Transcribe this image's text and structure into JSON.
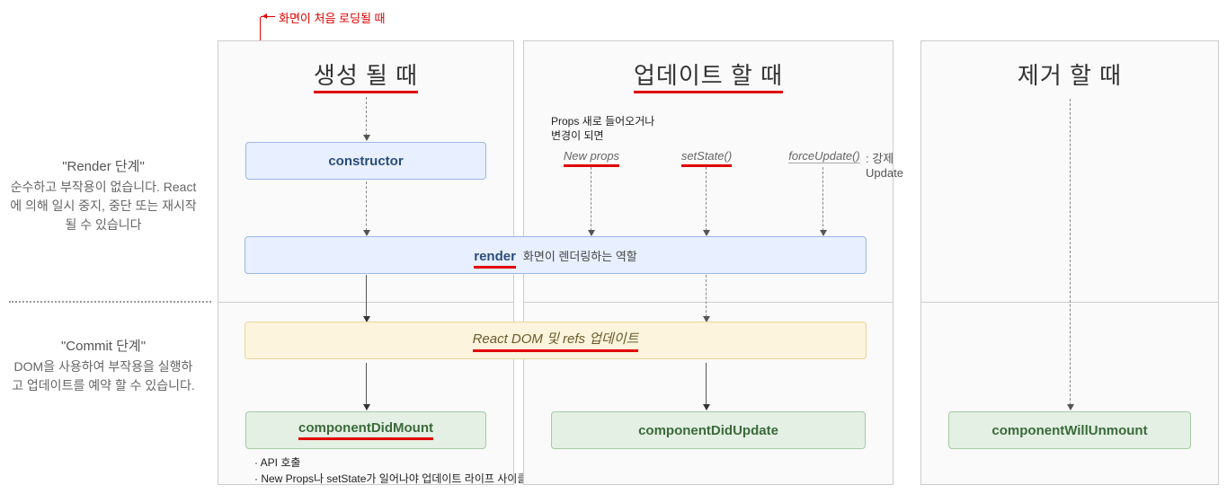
{
  "annotations": {
    "top": "화면이 처음 로딩될 때",
    "props_note_line1": "Props 새로 들어오거나",
    "props_note_line2": "변경이 되면",
    "force_note": ": 강제 Update",
    "render_note": "화면이 렌더링하는 역할",
    "bottom_note1": "· API 호출",
    "bottom_note2": "· New Props나 setState가 일어나야 업데이트 라이프 사이클을 탐"
  },
  "side": {
    "render_title": "\"Render 단계\"",
    "render_desc": "순수하고 부작용이 없습니다. React에 의해 일시 중지, 중단 또는 재시작 될 수 있습니다",
    "commit_title": "\"Commit 단계\"",
    "commit_desc": "DOM을 사용하여 부작용을 실행하고 업데이트를 예약 할 수 있습니다."
  },
  "columns": {
    "mount": "생성 될 때",
    "update": "업데이트 할 때",
    "unmount": "제거 할 때"
  },
  "triggers": {
    "newprops": "New props",
    "setstate": "setState()",
    "forceupdate": "forceUpdate()"
  },
  "boxes": {
    "constructor": "constructor",
    "render": "render",
    "domrefs": "React DOM 및 refs 업데이트",
    "didmount": "componentDidMount",
    "didupdate": "componentDidUpdate",
    "willunmount": "componentWillUnmount"
  }
}
